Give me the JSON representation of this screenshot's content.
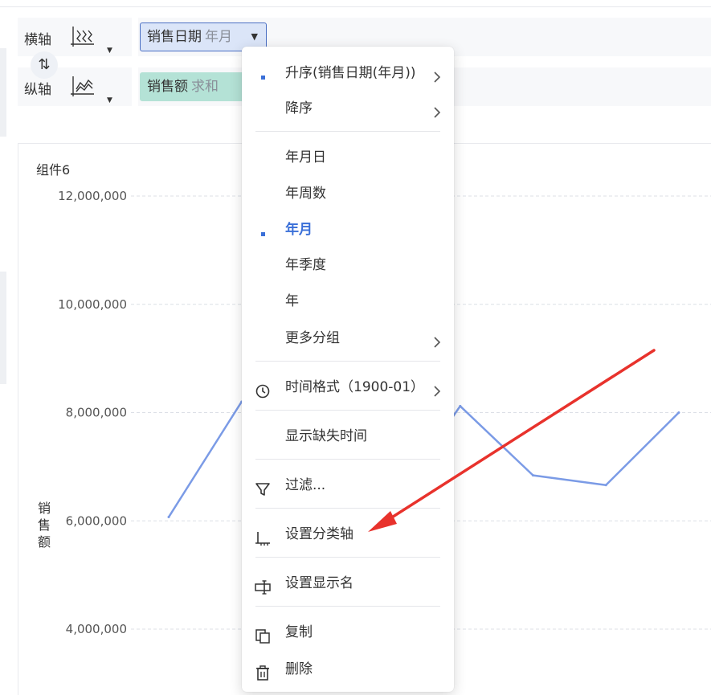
{
  "axis_panel": {
    "horizontal_label": "横轴",
    "vertical_label": "纵轴",
    "horizontal_pill": {
      "field": "销售日期",
      "modifier": "年月"
    },
    "vertical_pill": {
      "field": "销售额",
      "modifier": "求和"
    },
    "swap_glyph": "⇅"
  },
  "chart": {
    "title": "组件6",
    "y_axis_title": "销售额"
  },
  "chart_data": {
    "type": "line",
    "ylabel": "销售额",
    "ylim": [
      3500000,
      12500000
    ],
    "y_ticks": [
      12000000,
      10000000,
      8000000,
      6000000,
      4000000
    ],
    "y_tick_labels": [
      "12,000,000",
      "10,000,000",
      "8,000,000",
      "6,000,000",
      "4,000,000"
    ],
    "grid": true,
    "series_color": "#7b9be6",
    "points": [
      {
        "i": 0,
        "y": 6070000
      },
      {
        "i": 1,
        "y": 8200000
      },
      {
        "i": 3,
        "y": 6170000
      },
      {
        "i": 4,
        "y": 8120000
      },
      {
        "i": 5,
        "y": 6840000
      },
      {
        "i": 6,
        "y": 6660000
      },
      {
        "i": 7,
        "y": 8000000
      }
    ]
  },
  "menu": {
    "sort_asc": "升序(销售日期(年月))",
    "sort_desc": "降序",
    "group_ymd": "年月日",
    "group_yw": "年周数",
    "group_ym": "年月",
    "group_yq": "年季度",
    "group_y": "年",
    "group_more": "更多分组",
    "time_format": "时间格式（1900-01）",
    "show_missing": "显示缺失时间",
    "filter": "过滤...",
    "set_category_axis": "设置分类轴",
    "set_display_name": "设置显示名",
    "copy": "复制",
    "delete": "删除"
  },
  "colors": {
    "accent": "#3a6fd8",
    "annotation_arrow": "#e8322c",
    "sales_pill": "#b4e2d6",
    "date_pill": "#dbe5f8"
  }
}
